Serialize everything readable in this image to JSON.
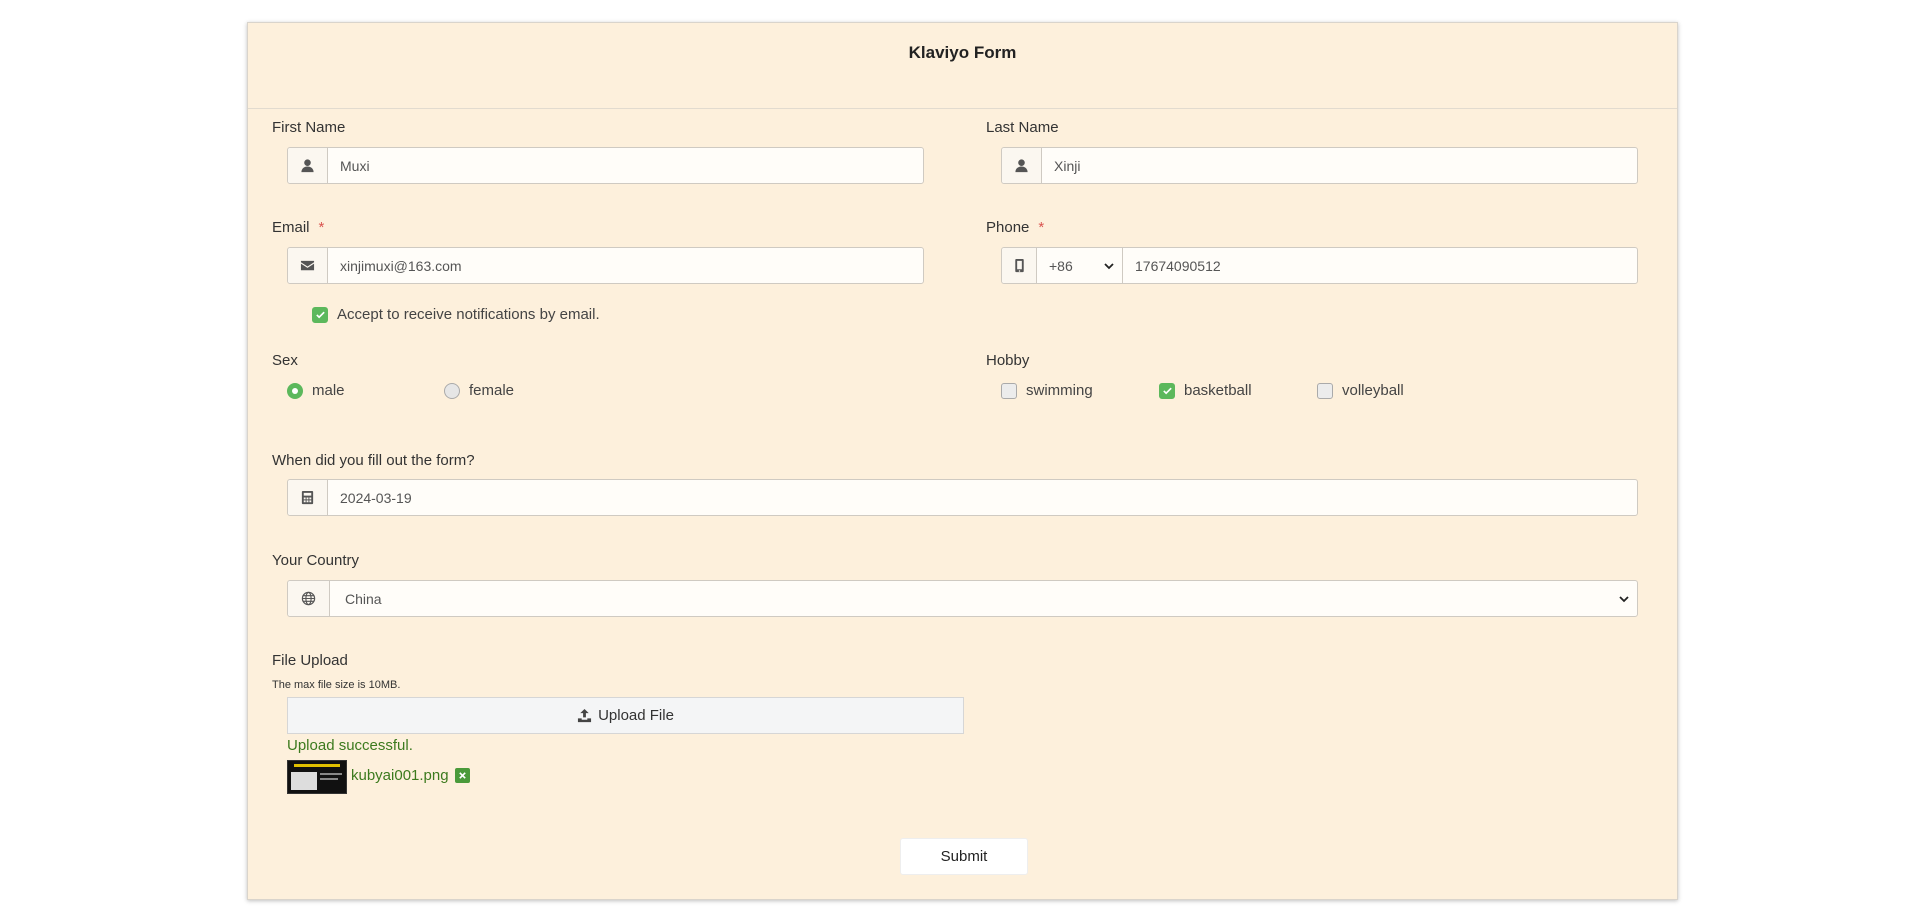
{
  "form": {
    "title": "Klaviyo Form"
  },
  "first_name": {
    "label": "First Name",
    "value": "Muxi",
    "icon": "user-icon"
  },
  "last_name": {
    "label": "Last Name",
    "value": "Xinji",
    "icon": "user-icon"
  },
  "email": {
    "label": "Email",
    "required_mark": "*",
    "value": "xinjimuxi@163.com",
    "icon": "envelope-icon"
  },
  "phone": {
    "label": "Phone",
    "required_mark": "*",
    "country_code": "+86",
    "value": "17674090512",
    "icon": "mobile-icon"
  },
  "notify": {
    "label": "Accept to receive notifications by email.",
    "checked": true
  },
  "sex": {
    "label": "Sex",
    "options": [
      {
        "label": "male",
        "selected": true
      },
      {
        "label": "female",
        "selected": false
      }
    ]
  },
  "hobby": {
    "label": "Hobby",
    "options": [
      {
        "label": "swimming",
        "checked": false
      },
      {
        "label": "basketball",
        "checked": true
      },
      {
        "label": "volleyball",
        "checked": false
      }
    ]
  },
  "date": {
    "label": "When did you fill out the form?",
    "value": "2024-03-19",
    "icon": "calculator-icon"
  },
  "country": {
    "label": "Your Country",
    "value": "China",
    "icon": "globe-icon"
  },
  "upload": {
    "label": "File Upload",
    "hint": "The max file size is 10MB.",
    "button_label": "Upload File",
    "status": "Upload successful.",
    "file_name": "kubyai001.png"
  },
  "submit": {
    "label": "Submit"
  },
  "colors": {
    "background": "#fdf0dc",
    "success": "#3c7a1e",
    "check": "#5cb85c",
    "required": "#d9534f"
  }
}
